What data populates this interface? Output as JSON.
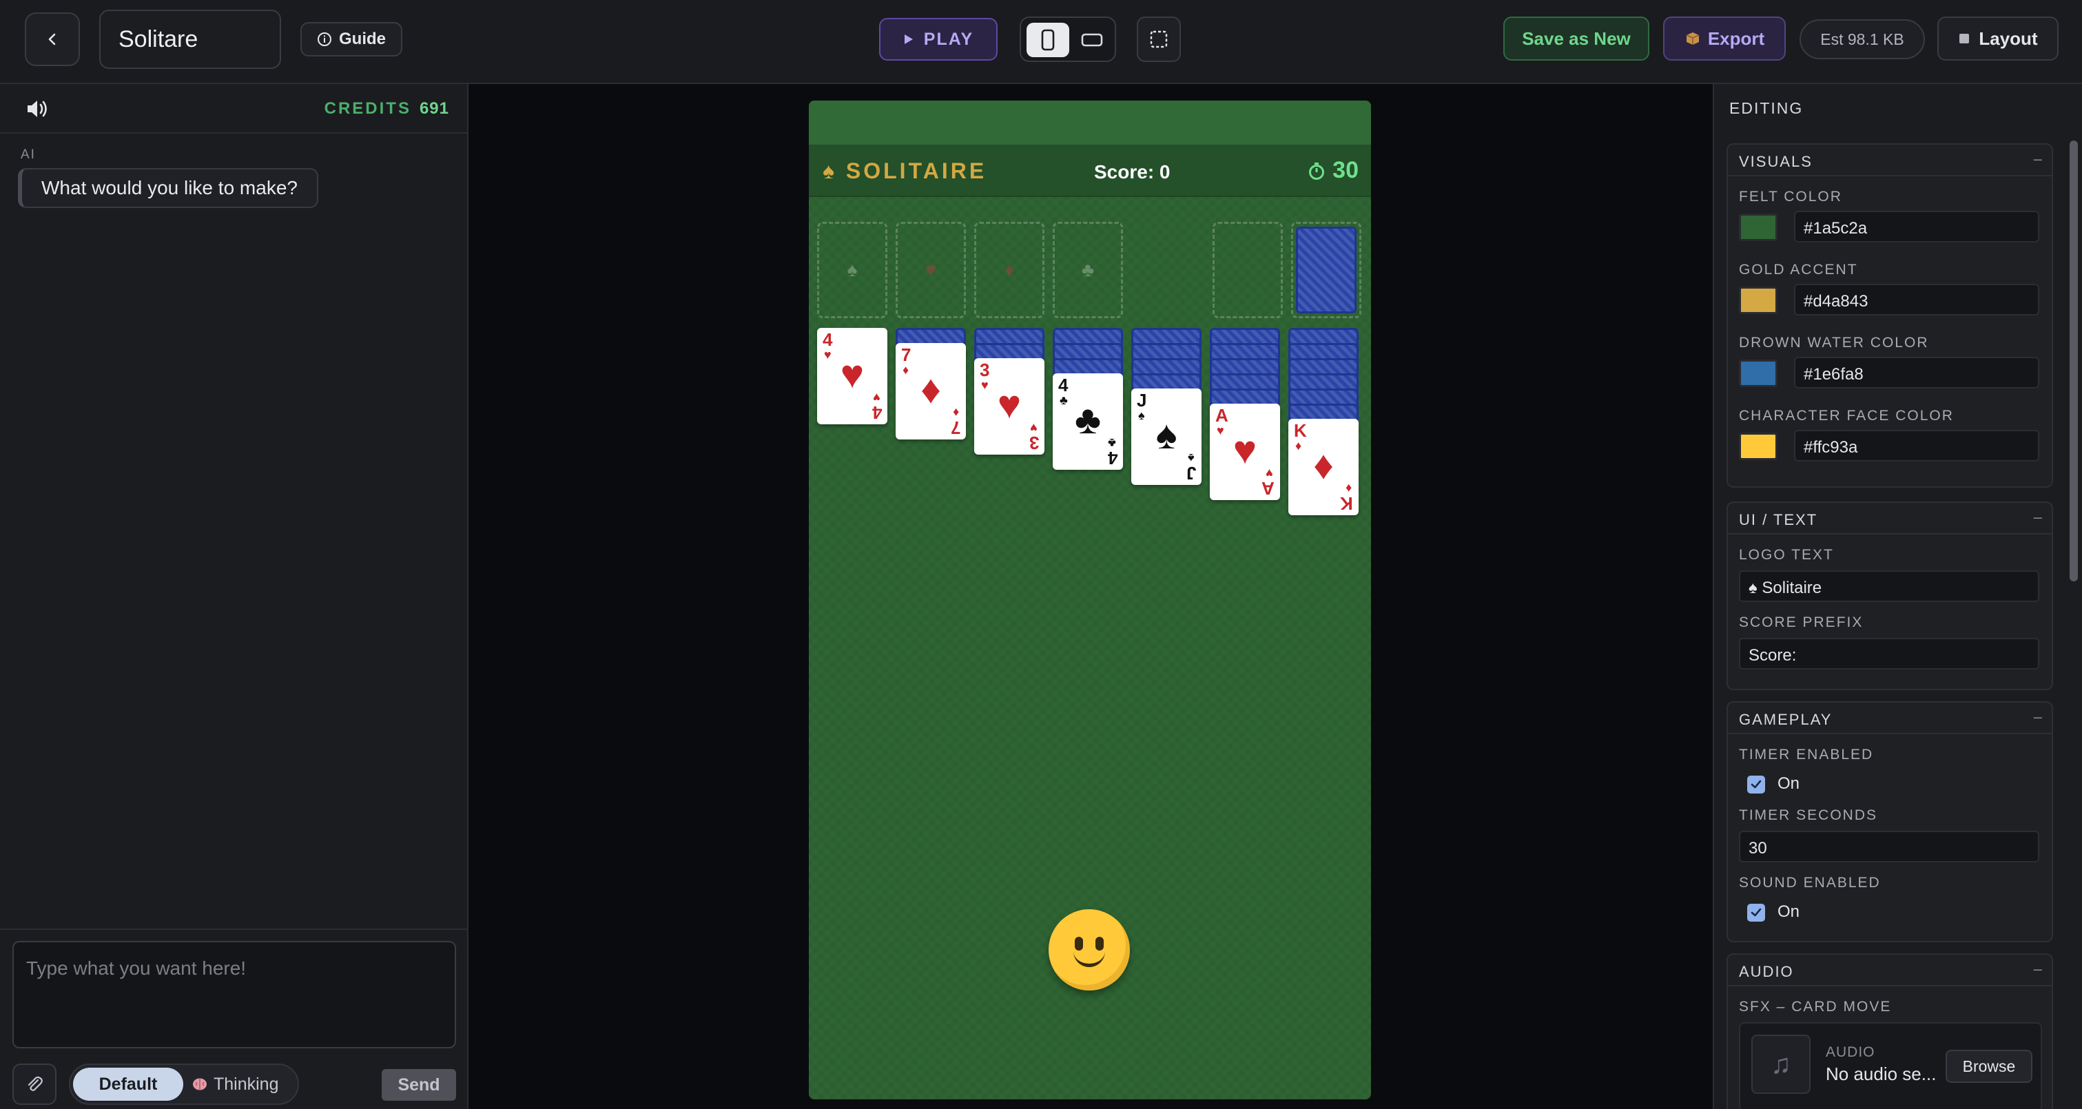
{
  "header": {
    "project_title": "Solitare",
    "guide_label": "Guide",
    "play_label": "PLAY",
    "save_label": "Save as New",
    "export_label": "Export",
    "size_label": "Est 98.1 KB",
    "layout_label": "Layout"
  },
  "chat": {
    "credits_label": "CREDITS",
    "credits_value": "691",
    "ai_label": "AI",
    "ai_message": "What would you like to make?",
    "input_placeholder": "Type what you want here!",
    "mode_default": "Default",
    "mode_thinking": "Thinking",
    "send_label": "Send"
  },
  "game": {
    "logo": "SOLITAIRE",
    "logo_icon": "♠",
    "score": "Score: 0",
    "timer": "30",
    "foundation_suits": [
      "♠",
      "♥",
      "♦",
      "♣"
    ],
    "tableau": [
      {
        "rank": "4",
        "suit": "♥",
        "color": "red",
        "hidden": 0
      },
      {
        "rank": "7",
        "suit": "♦",
        "color": "red",
        "hidden": 1
      },
      {
        "rank": "3",
        "suit": "♥",
        "color": "red",
        "hidden": 2
      },
      {
        "rank": "4",
        "suit": "♣",
        "color": "black",
        "hidden": 3
      },
      {
        "rank": "J",
        "suit": "♠",
        "color": "black",
        "hidden": 4
      },
      {
        "rank": "A",
        "suit": "♥",
        "color": "red",
        "hidden": 5
      },
      {
        "rank": "K",
        "suit": "♦",
        "color": "red",
        "hidden": 6
      }
    ]
  },
  "editor": {
    "title": "EDITING",
    "visuals": {
      "title": "VISUALS",
      "felt_label": "FELT COLOR",
      "felt_value": "#1a5c2a",
      "gold_label": "GOLD ACCENT",
      "gold_value": "#d4a843",
      "water_label": "DROWN WATER COLOR",
      "water_value": "#1e6fa8",
      "face_label": "CHARACTER FACE COLOR",
      "face_value": "#ffc93a"
    },
    "ui_text": {
      "title": "UI / TEXT",
      "logo_label": "LOGO TEXT",
      "logo_value": "♠ Solitaire",
      "score_label": "SCORE PREFIX",
      "score_value": "Score:"
    },
    "gameplay": {
      "title": "GAMEPLAY",
      "timer_enabled_label": "TIMER ENABLED",
      "timer_enabled_value": "On",
      "timer_seconds_label": "TIMER SECONDS",
      "timer_seconds_value": "30",
      "sound_enabled_label": "SOUND ENABLED",
      "sound_enabled_value": "On"
    },
    "audio": {
      "title": "AUDIO",
      "sfx_label": "SFX – CARD MOVE",
      "kind_label": "AUDIO",
      "file_name": "No audio se...",
      "browse_label": "Browse"
    },
    "collapse_glyph": "–"
  }
}
